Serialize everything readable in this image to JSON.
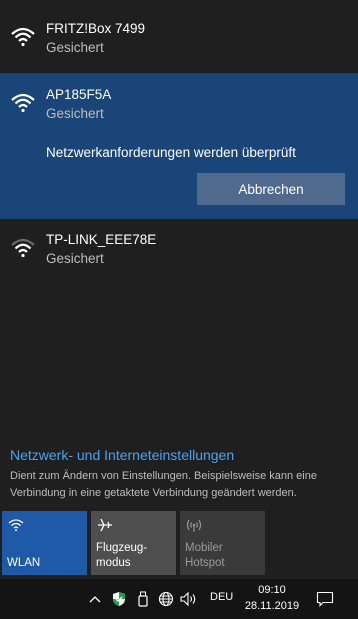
{
  "networks": [
    {
      "name": "FRITZ!Box 7499",
      "status": "Gesichert",
      "signal_icon": "wifi-full-icon"
    },
    {
      "name": "AP185F5A",
      "status": "Gesichert",
      "signal_icon": "wifi-full-icon",
      "checking_text": "Netzwerkanforderungen werden überprüft",
      "cancel_label": "Abbrechen"
    },
    {
      "name": "TP-LINK_EEE78E",
      "status": "Gesichert",
      "signal_icon": "wifi-medium-icon"
    }
  ],
  "settings": {
    "link": "Netzwerk- und Interneteinstellungen",
    "description": "Dient zum Ändern von Einstellungen. Beispielsweise kann eine Verbindung in eine getaktete Verbindung geändert werden."
  },
  "quick_actions": [
    {
      "label": "WLAN",
      "icon": "wifi-icon",
      "active": true
    },
    {
      "label": "Flugzeug-\nmodus",
      "icon": "airplane-icon",
      "active": false
    },
    {
      "label": "Mobiler\nHotspot",
      "icon": "hotspot-icon",
      "active": false,
      "disabled": true
    }
  ],
  "taskbar": {
    "language": "DEU",
    "time": "09:10",
    "date": "28.11.2019"
  },
  "colors": {
    "selected_bg": "#1a4578",
    "accent": "#1f5aa8",
    "link": "#4aa3ee"
  }
}
